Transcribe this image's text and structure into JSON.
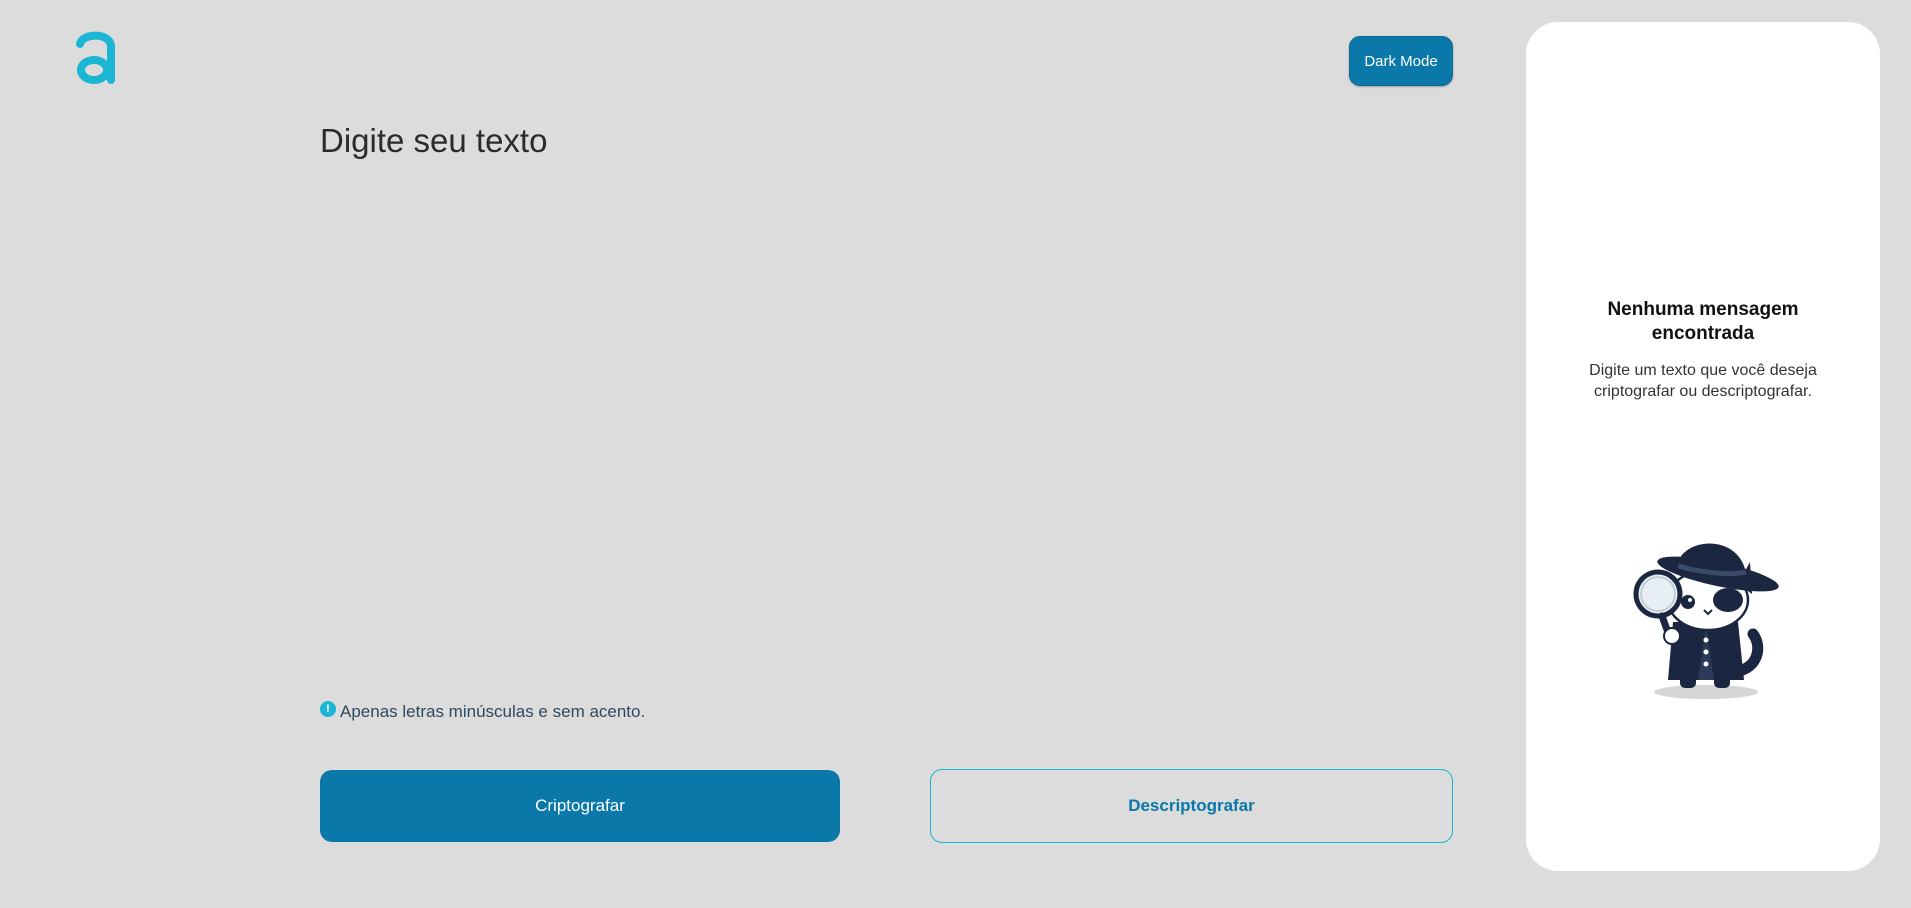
{
  "header": {
    "logo_icon": "letter-a-logo-icon",
    "dark_mode_label": "Dark Mode"
  },
  "editor": {
    "placeholder": "Digite seu texto",
    "value": ""
  },
  "hint": {
    "icon": "exclamation-circle-icon",
    "text": "Apenas letras minúsculas e sem acento."
  },
  "actions": {
    "encrypt_label": "Criptografar",
    "decrypt_label": "Descriptografar"
  },
  "output_panel": {
    "title": "Nenhuma mensagem encontrada",
    "description": "Digite um texto que você deseja criptografar ou descriptografar.",
    "illustration": "detective-cat-illustration"
  },
  "colors": {
    "background": "#dcdcdc",
    "primary": "#0a78a8",
    "accent": "#1ab6d3",
    "panel": "#ffffff"
  }
}
